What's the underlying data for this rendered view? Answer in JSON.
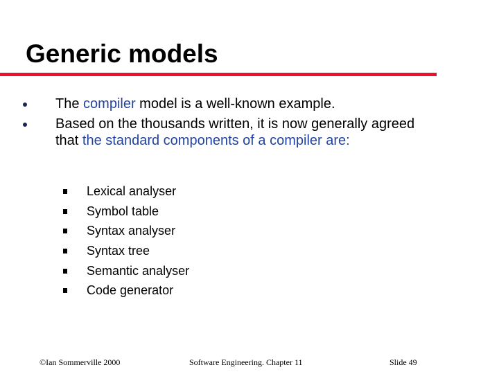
{
  "slide": {
    "title": "Generic models",
    "accent_color": "#e3142d",
    "highlight_color": "#2244a0",
    "bullets": [
      {
        "segments": [
          {
            "text": "The ",
            "highlight": false
          },
          {
            "text": "compiler",
            "highlight": true
          },
          {
            "text": " model is a well-known example.",
            "highlight": false
          }
        ]
      },
      {
        "segments": [
          {
            "text": "Based on the thousands written, it is now generally agreed that ",
            "highlight": false
          },
          {
            "text": "the standard components of a compiler are:",
            "highlight": true
          }
        ]
      }
    ],
    "sub_bullets": [
      "Lexical analyser",
      "Symbol table",
      "Syntax analyser",
      "Syntax tree",
      "Semantic analyser",
      "Code generator"
    ]
  },
  "footer": {
    "copyright": "©Ian Sommerville 2000",
    "course": "Software Engineering. Chapter 11",
    "slide_number": "Slide 49"
  }
}
